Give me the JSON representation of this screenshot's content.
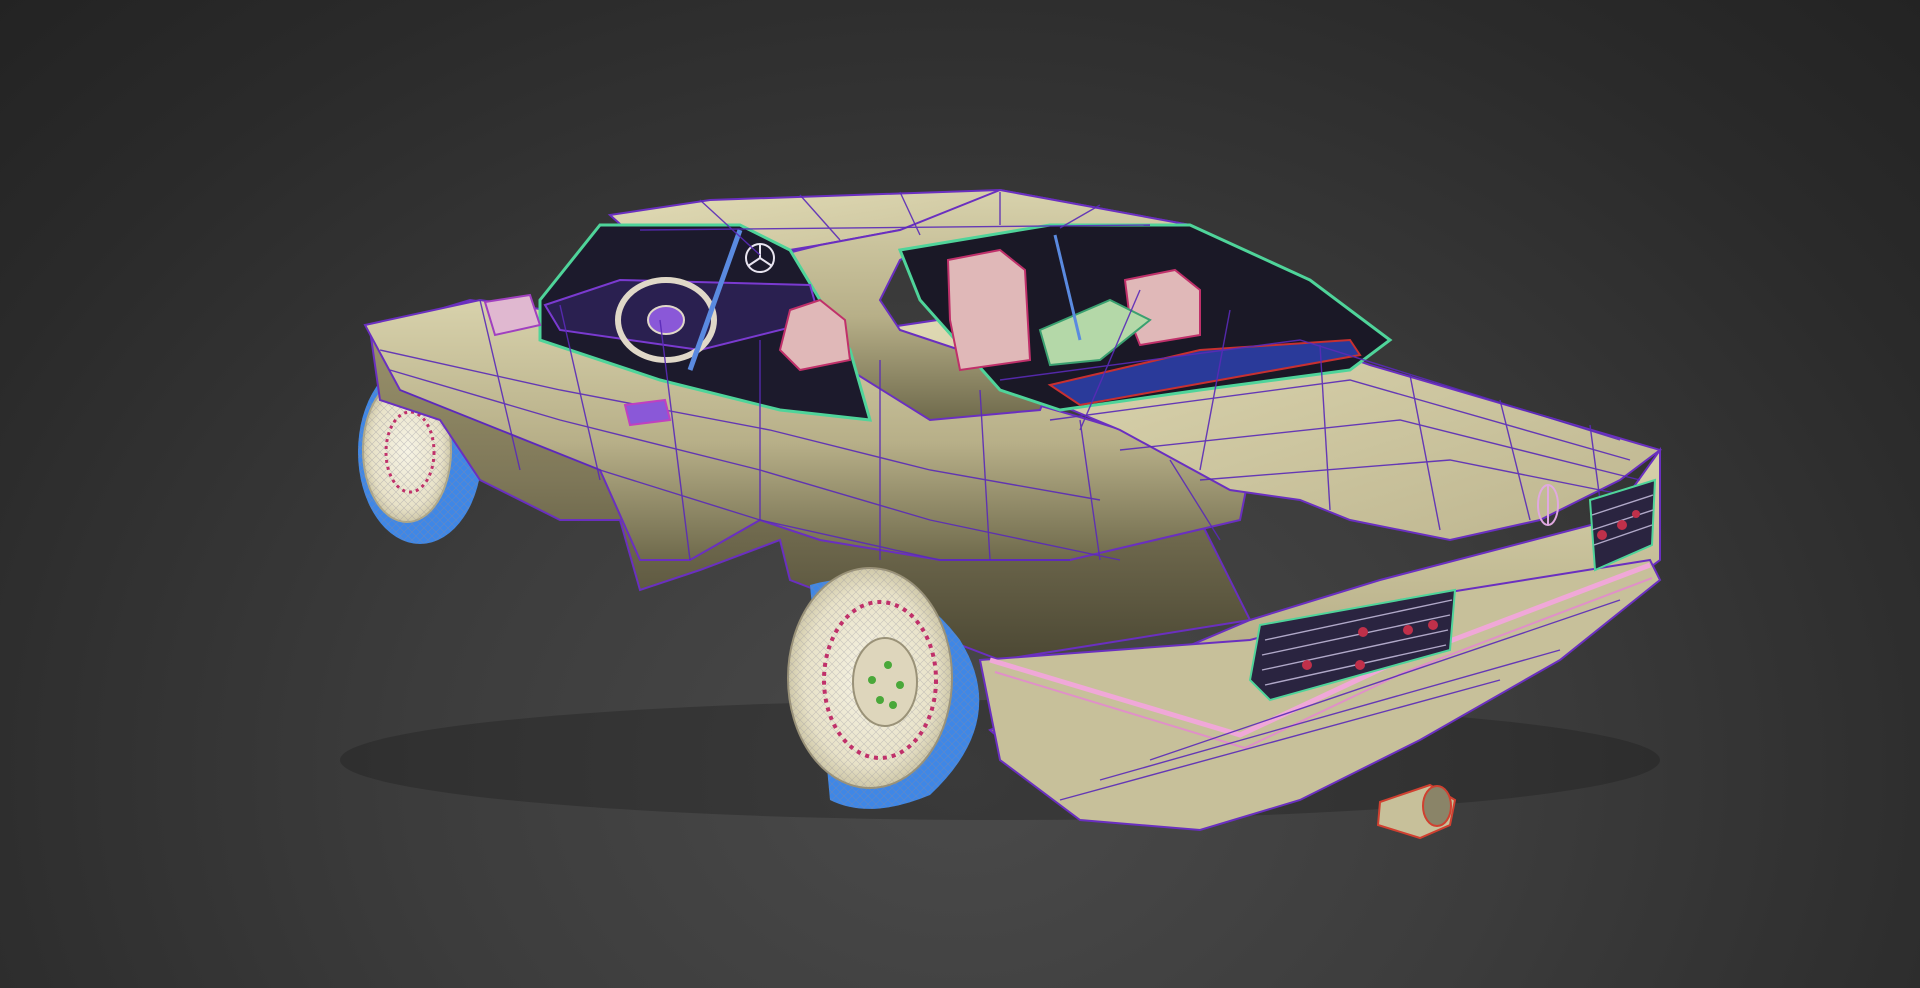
{
  "viewport": {
    "background_top": "#222222",
    "background_bottom": "#474747"
  },
  "model": {
    "body_color": "#c8c19c",
    "body_shadow": "#857e5c",
    "wire_primary": "#6a2fc0",
    "wire_secondary": "#3a2a90",
    "tire_color": "#3f87e6",
    "rim_color": "#f0ecd8",
    "seat_color": "#e0b8b8",
    "seat_wire": "#c0306a",
    "trim_green": "#4fd49a",
    "trim_pink": "#f0a8d8",
    "taillight_dot": "#c0304a",
    "exhaust_wire": "#d04030",
    "icons": [
      "mercedes-star-icon",
      "mercedes-star-icon"
    ]
  }
}
